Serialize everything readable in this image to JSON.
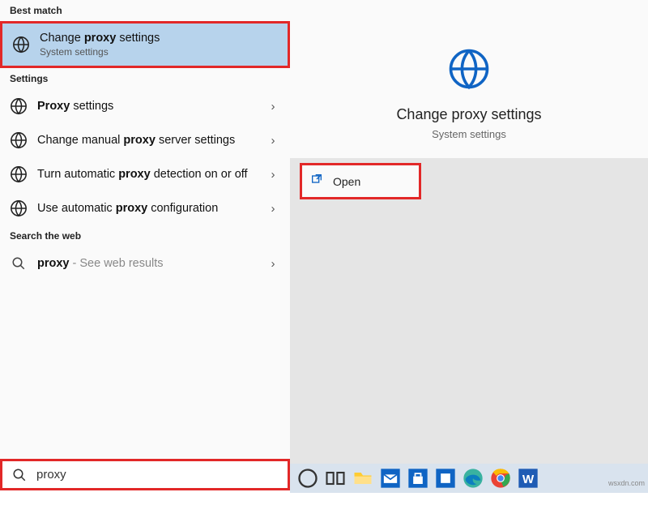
{
  "sections": {
    "best_match_header": "Best match",
    "settings_header": "Settings",
    "web_header": "Search the web"
  },
  "best_match": {
    "title_pre": "Change ",
    "title_bold": "proxy",
    "title_post": " settings",
    "subtitle": "System settings"
  },
  "results": [
    {
      "pre": "",
      "bold": "Proxy",
      "post": " settings"
    },
    {
      "pre": "Change manual ",
      "bold": "proxy",
      "post": " server settings"
    },
    {
      "pre": "Turn automatic ",
      "bold": "proxy",
      "post": " detection on or off"
    },
    {
      "pre": "Use automatic ",
      "bold": "proxy",
      "post": " configuration"
    }
  ],
  "web_result": {
    "term": "proxy",
    "hint": " - See web results"
  },
  "detail": {
    "title": "Change proxy settings",
    "subtitle": "System settings"
  },
  "open": {
    "label": "Open"
  },
  "search": {
    "value": "proxy"
  },
  "watermark": "wsxdn.com",
  "colors": {
    "accent": "#0f64c4",
    "highlight_border": "#e22828"
  }
}
